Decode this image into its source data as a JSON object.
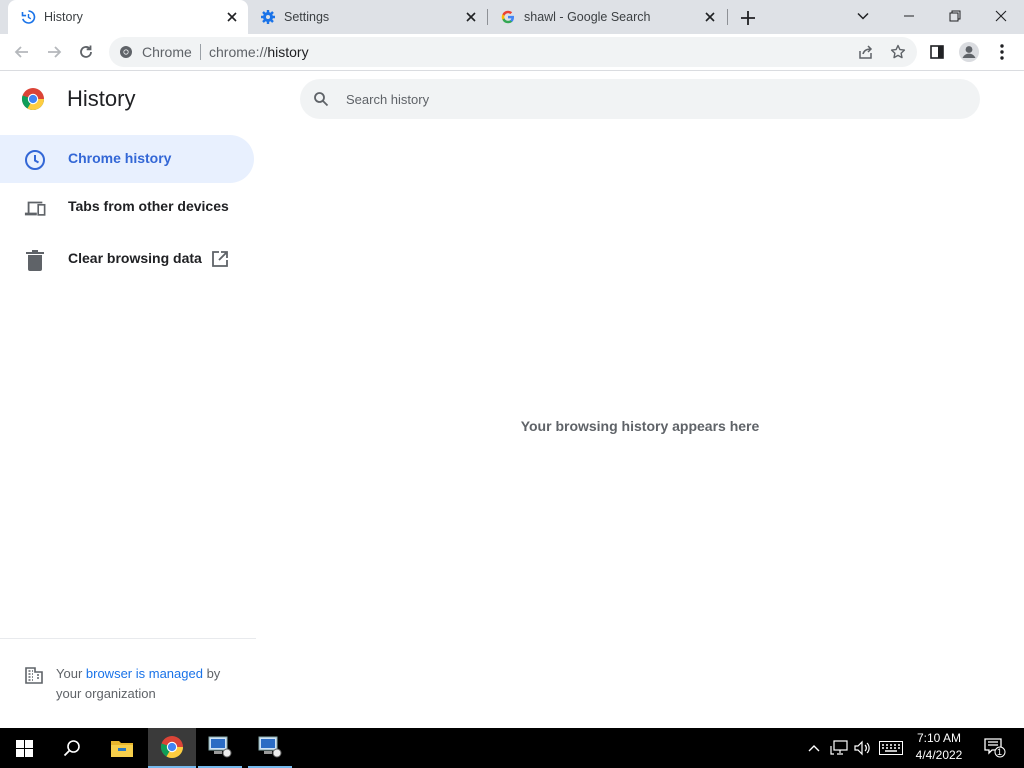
{
  "tabs": [
    {
      "title": "History",
      "icon": "history-icon",
      "active": true
    },
    {
      "title": "Settings",
      "icon": "settings-gear-icon",
      "active": false
    },
    {
      "title": "shawl - Google Search",
      "icon": "google-icon",
      "active": false
    }
  ],
  "omnibox": {
    "chip": "Chrome",
    "url_scheme": "chrome://",
    "url_path": "history"
  },
  "page": {
    "title": "History",
    "search_placeholder": "Search history",
    "empty_message": "Your browsing history appears here"
  },
  "nav": {
    "items": [
      {
        "label": "Chrome history",
        "icon": "clock-icon",
        "selected": true
      },
      {
        "label": "Tabs from other devices",
        "icon": "devices-icon",
        "selected": false
      },
      {
        "label": "Clear browsing data",
        "icon": "trash-icon",
        "selected": false
      }
    ]
  },
  "managed": {
    "prefix": "Your ",
    "link": "browser is managed",
    "suffix": " by your organization"
  },
  "taskbar": {
    "time": "7:10 AM",
    "date": "4/4/2022",
    "notification_count": "1"
  },
  "colors": {
    "accent": "#1a73e8",
    "selected_bg": "#e8f0fe",
    "tabstrip": "#dee1e6"
  }
}
